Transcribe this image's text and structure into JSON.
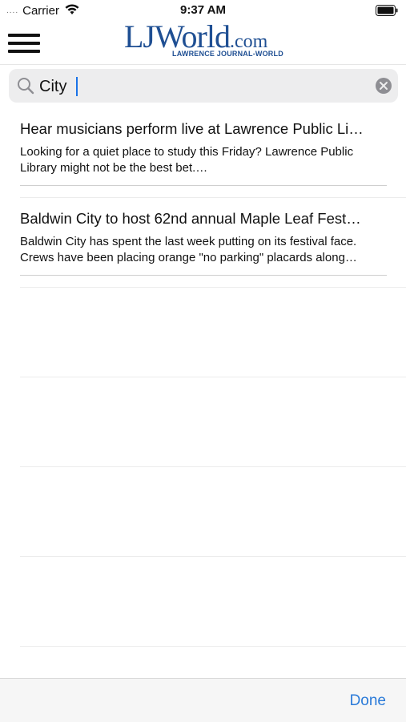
{
  "status_bar": {
    "dots": "....",
    "carrier": "Carrier",
    "time": "9:37 AM"
  },
  "header": {
    "logo_main": "LJWorld",
    "logo_com": ".com",
    "logo_subtitle": "LAWRENCE JOURNAL-WORLD"
  },
  "search": {
    "value": "City"
  },
  "results": [
    {
      "title": "Hear musicians perform live at Lawrence Public Li…",
      "snippet": "Looking for a quiet place to study this Friday? Lawrence Public Library might not be the best bet.…"
    },
    {
      "title": "Baldwin City to host 62nd annual Maple Leaf Fest…",
      "snippet": "Baldwin City has spent the last week putting on its festival face. Crews have been placing orange \"no parking\" placards along…"
    }
  ],
  "toolbar": {
    "done_label": "Done"
  },
  "colors": {
    "accent": "#2a7ad8",
    "logo": "#1f4f93"
  }
}
